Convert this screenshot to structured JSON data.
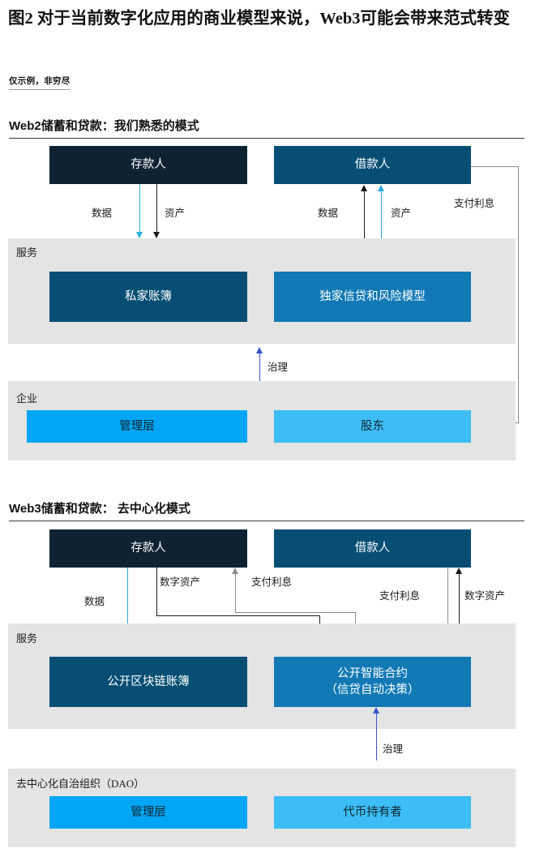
{
  "figure": {
    "title": "图2 对于当前数字化应用的商业模型来说，Web3可能会带来范式转变",
    "note": "仅示例，非穷尽"
  },
  "colors": {
    "navy": "#0d2334",
    "teal": "#064e74",
    "blue": "#1279b5",
    "azure": "#00a6f5",
    "azure_light": "#3cbdf5",
    "panel_grey": "#e4e4e4",
    "arrow_black": "#1a1a1a",
    "arrow_cyan": "#29abe2",
    "arrow_grey": "#8c8c8c",
    "arrow_indigo": "#3355cc"
  },
  "web2": {
    "heading": "Web2储蓄和贷款：我们熟悉的模式",
    "actors": [
      {
        "label": "存款人",
        "role": "depositor"
      },
      {
        "label": "借款人",
        "role": "borrower"
      }
    ],
    "service_panel": {
      "label": "服务",
      "boxes": [
        {
          "label": "私家账簿"
        },
        {
          "label": "独家信贷和风险模型"
        }
      ]
    },
    "enterprise_panel": {
      "label": "企业",
      "boxes": [
        {
          "label": "管理层"
        },
        {
          "label": "股东"
        }
      ]
    },
    "flows": [
      {
        "label": "数据",
        "from": "存款人",
        "to": "服务",
        "dir": "down",
        "color": "cyan"
      },
      {
        "label": "资产",
        "from": "存款人",
        "to": "服务",
        "dir": "down",
        "color": "black"
      },
      {
        "label": "数据",
        "from": "服务",
        "to": "借款人",
        "dir": "up",
        "color": "black"
      },
      {
        "label": "资产",
        "from": "服务",
        "to": "借款人",
        "dir": "up",
        "color": "cyan"
      },
      {
        "label": "支付利息",
        "from": "借款人",
        "to": "股东",
        "dir": "left",
        "color": "grey"
      },
      {
        "label": "治理",
        "from": "企业",
        "to": "服务",
        "dir": "up",
        "color": "indigo"
      }
    ]
  },
  "web3": {
    "heading": "Web3储蓄和贷款： 去中心化模式",
    "actors": [
      {
        "label": "存款人",
        "role": "depositor"
      },
      {
        "label": "借款人",
        "role": "borrower"
      }
    ],
    "service_panel": {
      "label": "服务",
      "boxes": [
        {
          "label": "公开区块链账簿"
        },
        {
          "label_line1": "公开智能合约",
          "label_line2": "（信贷自动决策）"
        }
      ]
    },
    "dao_panel": {
      "label": "去中心化自治组织（DAO）",
      "boxes": [
        {
          "label": "管理层"
        },
        {
          "label": "代币持有者"
        }
      ]
    },
    "flows": [
      {
        "label": "数据",
        "from": "存款人",
        "to": "公开区块链账簿",
        "dir": "down",
        "color": "cyan"
      },
      {
        "label": "数字资产",
        "from": "存款人",
        "to": "公开智能合约",
        "dir": "down",
        "color": "black"
      },
      {
        "label": "支付利息",
        "from": "公开智能合约",
        "to": "存款人",
        "dir": "up",
        "color": "grey"
      },
      {
        "label": "支付利息",
        "from": "借款人",
        "to": "公开智能合约",
        "dir": "down",
        "color": "grey"
      },
      {
        "label": "数字资产",
        "from": "公开智能合约",
        "to": "借款人",
        "dir": "up",
        "color": "black"
      },
      {
        "label": "治理",
        "from": "去中心化自治组织（DAO）",
        "to": "公开智能合约",
        "dir": "up",
        "color": "indigo"
      }
    ]
  }
}
